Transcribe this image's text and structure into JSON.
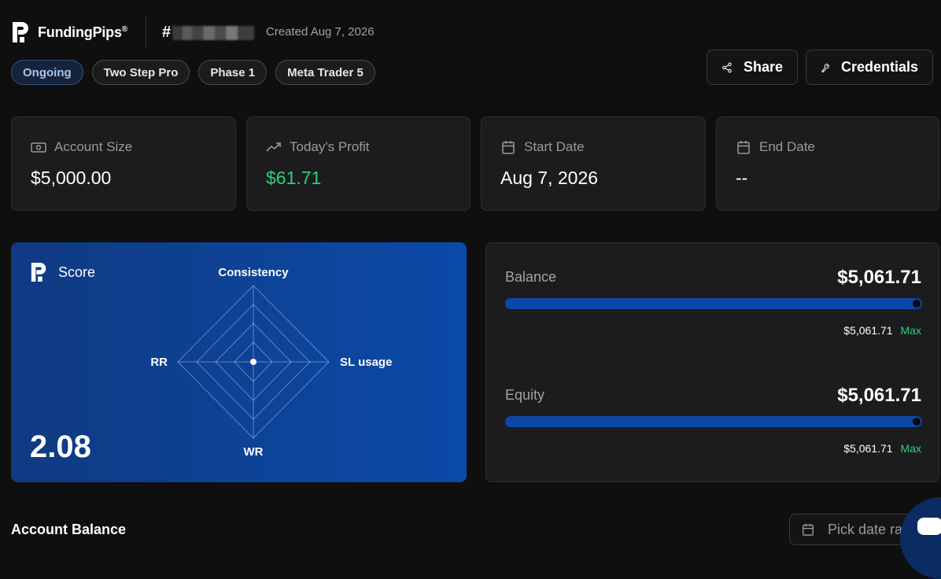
{
  "header": {
    "brand": "FundingPips",
    "brand_mark": "®",
    "account_prefix": "#",
    "created": "Created Aug 7, 2026",
    "tags": [
      "Ongoing",
      "Two Step Pro",
      "Phase 1",
      "Meta Trader 5"
    ],
    "share_label": "Share",
    "credentials_label": "Credentials"
  },
  "stats": [
    {
      "label": "Account Size",
      "value": "$5,000.00",
      "icon": "money-icon"
    },
    {
      "label": "Today's Profit",
      "value": "$61.71",
      "icon": "trending-up-icon"
    },
    {
      "label": "Start Date",
      "value": "Aug 7, 2026",
      "icon": "calendar-icon"
    },
    {
      "label": "End Date",
      "value": "--",
      "icon": "calendar-icon"
    }
  ],
  "score": {
    "title": "Score",
    "value": "2.08",
    "axes": {
      "top": "Consistency",
      "right": "SL usage",
      "bottom": "WR",
      "left": "RR"
    }
  },
  "balance": {
    "label": "Balance",
    "value": "$5,061.71",
    "sub_value": "$5,061.71",
    "sub_tag": "Max",
    "progress": 1.0
  },
  "equity": {
    "label": "Equity",
    "value": "$5,061.71",
    "sub_value": "$5,061.71",
    "sub_tag": "Max",
    "progress": 1.0
  },
  "account_balance": {
    "title": "Account Balance",
    "date_placeholder": "Pick date ra"
  },
  "colors": {
    "background": "#0f0f10",
    "card": "#1c1c1e",
    "accent_blue": "#0b47a6",
    "profit_green": "#2ecf7a"
  }
}
